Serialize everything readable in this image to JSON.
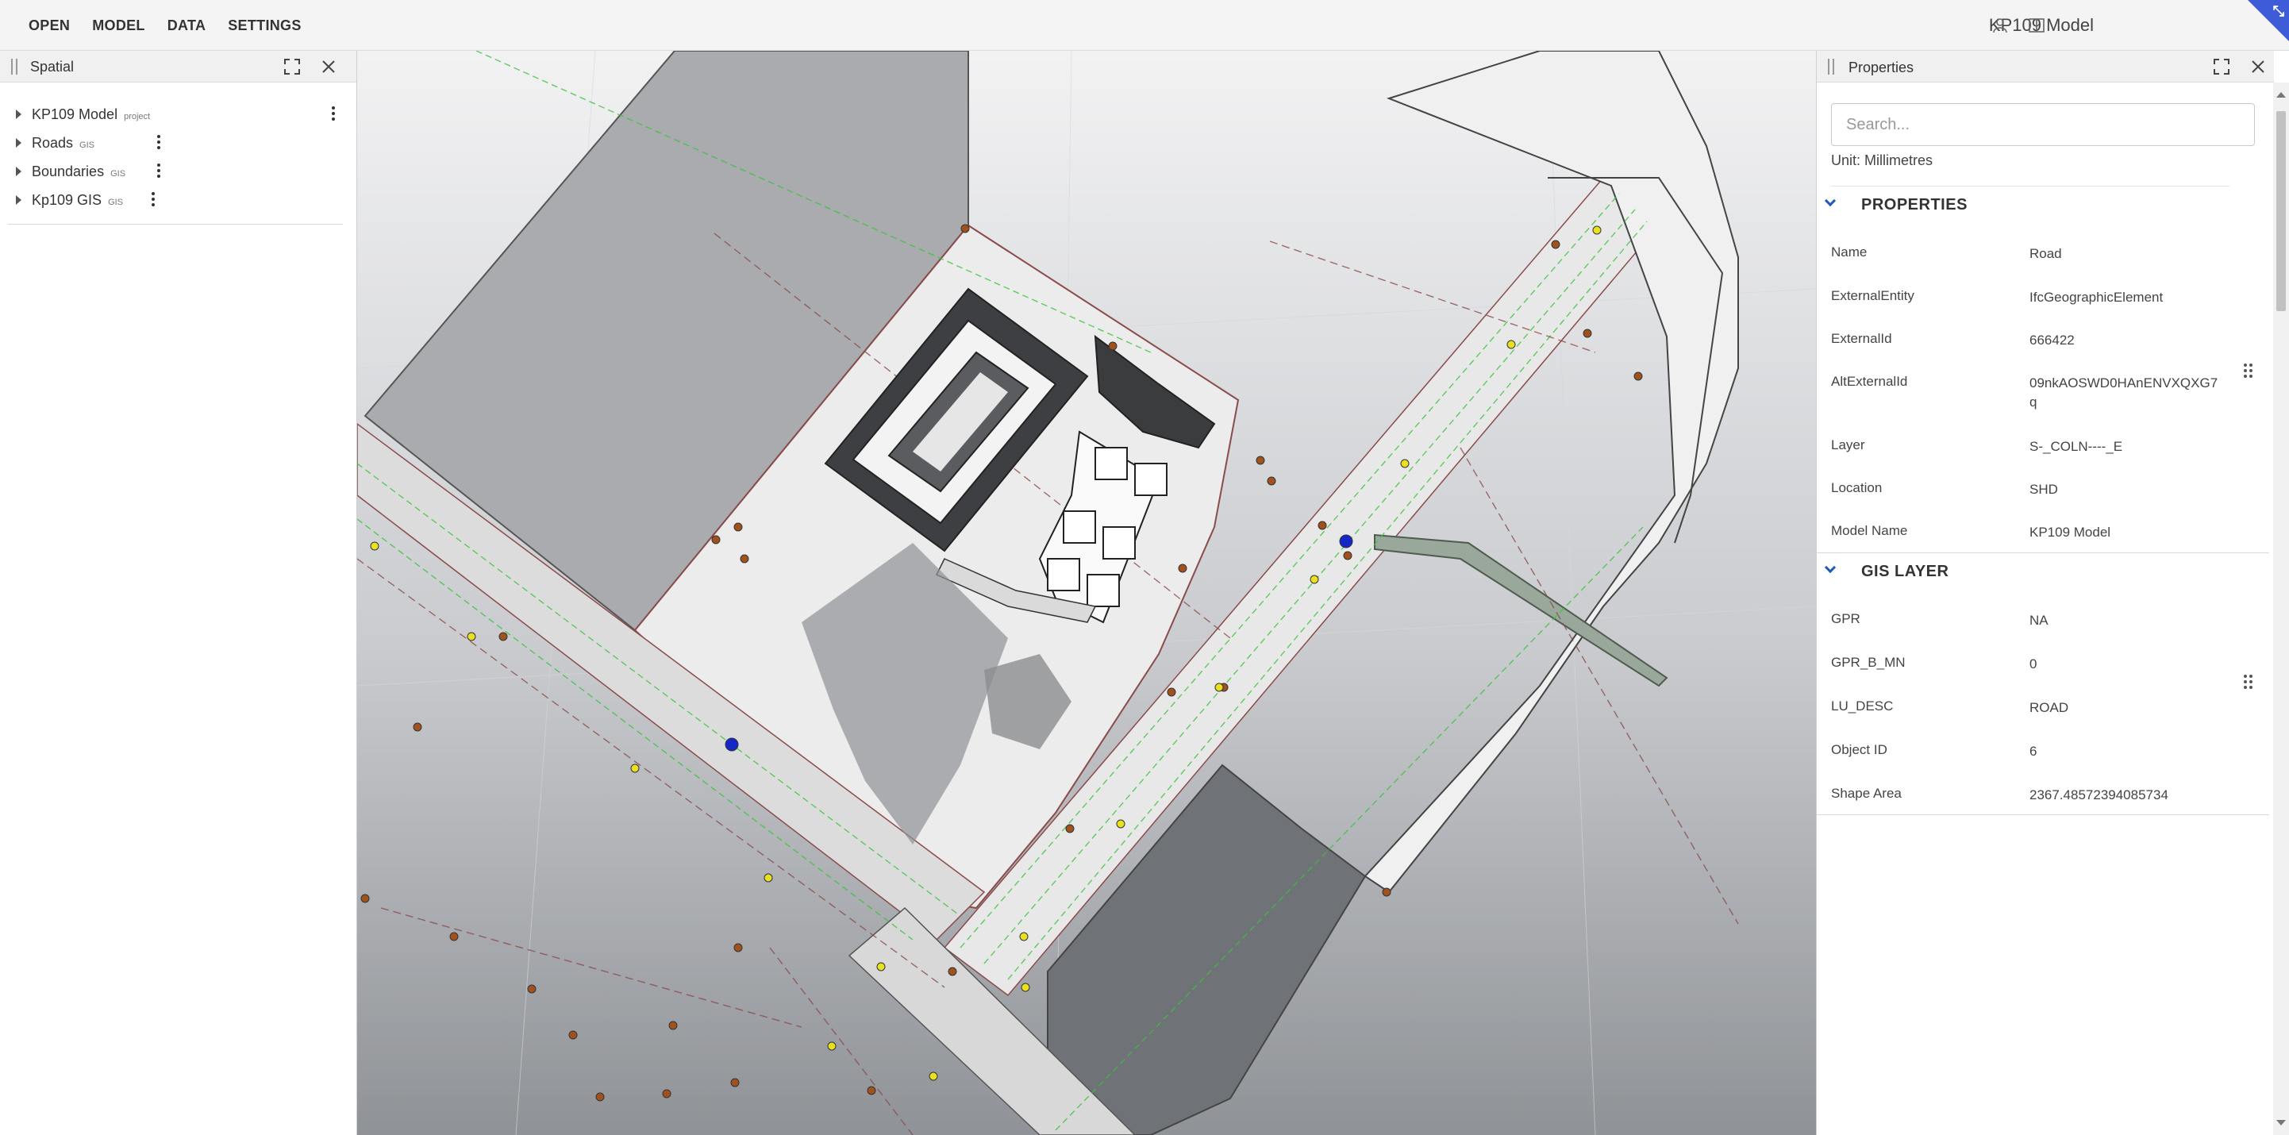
{
  "menu": {
    "open": "OPEN",
    "model": "MODEL",
    "data": "DATA",
    "settings": "SETTINGS"
  },
  "app": {
    "title": "KP109 Model"
  },
  "spatial": {
    "title": "Spatial",
    "items": [
      {
        "label": "KP109 Model",
        "tag": "project"
      },
      {
        "label": "Roads",
        "tag": "GIS"
      },
      {
        "label": "Boundaries",
        "tag": "GIS"
      },
      {
        "label": "Kp109 GIS",
        "tag": "GIS"
      }
    ]
  },
  "properties": {
    "title": "Properties",
    "search_placeholder": "Search...",
    "unit": "Unit: Millimetres",
    "sections": [
      {
        "title": "PROPERTIES",
        "rows": [
          {
            "key": "Name",
            "value": "Road"
          },
          {
            "key": "ExternalEntity",
            "value": "IfcGeographicElement"
          },
          {
            "key": "ExternalId",
            "value": "666422"
          },
          {
            "key": "AltExternalId",
            "value": "09nkAOSWD0HAnENVXQXG7q"
          },
          {
            "key": "Layer",
            "value": "S-_COLN----_E"
          },
          {
            "key": "Location",
            "value": "SHD"
          },
          {
            "key": "Model Name",
            "value": "KP109 Model"
          }
        ]
      },
      {
        "title": "GIS LAYER",
        "rows": [
          {
            "key": "GPR",
            "value": "NA"
          },
          {
            "key": "GPR_B_MN",
            "value": "0"
          },
          {
            "key": "LU_DESC",
            "value": "ROAD"
          },
          {
            "key": "Object ID",
            "value": "6"
          },
          {
            "key": "Shape Area",
            "value": "2367.48572394085734"
          }
        ]
      }
    ]
  },
  "colors": {
    "accent": "#1f5ab8",
    "corner": "#3e5bd8",
    "boundary_line": "#8a4b4b",
    "survey_line": "#3cc23c",
    "marker_orange": "#a0521e",
    "marker_yellow": "#e8e020",
    "marker_blue": "#1428c8"
  }
}
